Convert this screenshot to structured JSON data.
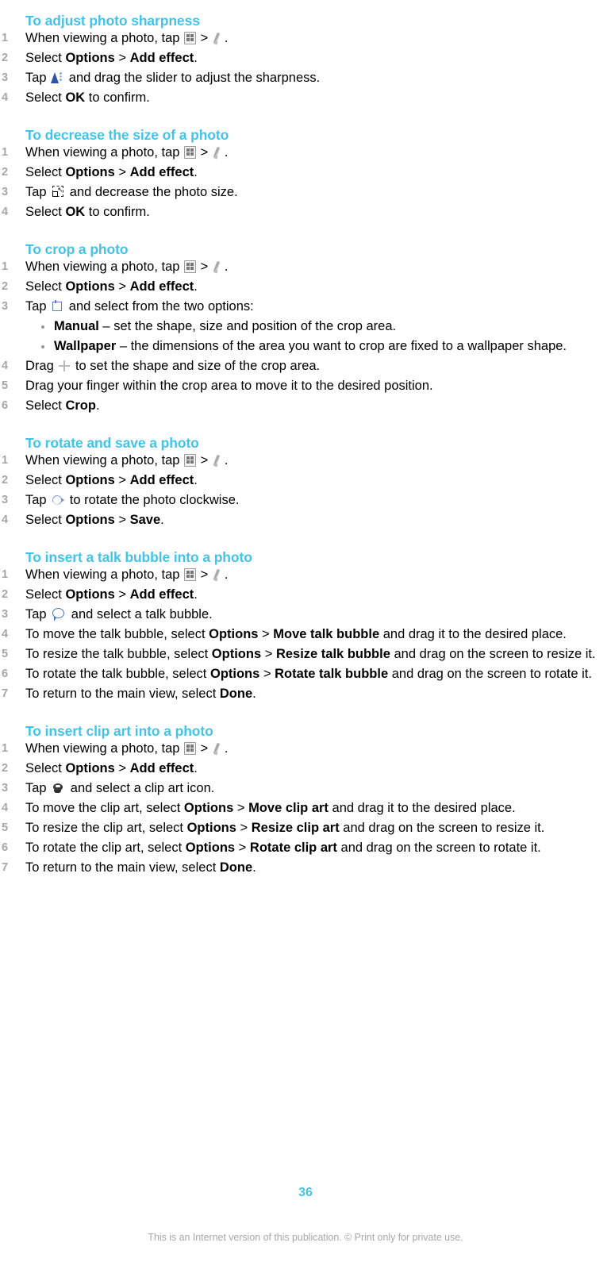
{
  "document": {
    "page_number": "36",
    "footer_note": "This is an Internet version of this publication. © Print only for private use.",
    "accent_color": "#42c3ea",
    "number_color": "#a6a6a6"
  },
  "sections": [
    {
      "title": "To adjust photo sharpness",
      "steps": [
        {
          "parts": [
            {
              "t": "text",
              "v": "When viewing a photo, tap "
            },
            {
              "t": "icon",
              "v": "gallery-icon"
            },
            {
              "t": "text",
              "v": " > "
            },
            {
              "t": "icon",
              "v": "pen-icon"
            },
            {
              "t": "text",
              "v": "."
            }
          ]
        },
        {
          "parts": [
            {
              "t": "text",
              "v": "Select "
            },
            {
              "t": "bold",
              "v": "Options"
            },
            {
              "t": "text",
              "v": " > "
            },
            {
              "t": "bold",
              "v": "Add effect"
            },
            {
              "t": "text",
              "v": "."
            }
          ]
        },
        {
          "parts": [
            {
              "t": "text",
              "v": "Tap "
            },
            {
              "t": "icon",
              "v": "sharpness-icon"
            },
            {
              "t": "text",
              "v": " and drag the slider to adjust the sharpness."
            }
          ]
        },
        {
          "parts": [
            {
              "t": "text",
              "v": "Select "
            },
            {
              "t": "bold",
              "v": "OK"
            },
            {
              "t": "text",
              "v": " to confirm."
            }
          ]
        }
      ]
    },
    {
      "title": "To decrease the size of a photo",
      "steps": [
        {
          "parts": [
            {
              "t": "text",
              "v": "When viewing a photo, tap "
            },
            {
              "t": "icon",
              "v": "gallery-icon"
            },
            {
              "t": "text",
              "v": " > "
            },
            {
              "t": "icon",
              "v": "pen-icon"
            },
            {
              "t": "text",
              "v": "."
            }
          ]
        },
        {
          "parts": [
            {
              "t": "text",
              "v": "Select "
            },
            {
              "t": "bold",
              "v": "Options"
            },
            {
              "t": "text",
              "v": " > "
            },
            {
              "t": "bold",
              "v": "Add effect"
            },
            {
              "t": "text",
              "v": "."
            }
          ]
        },
        {
          "parts": [
            {
              "t": "text",
              "v": "Tap "
            },
            {
              "t": "icon",
              "v": "resize-icon"
            },
            {
              "t": "text",
              "v": " and decrease the photo size."
            }
          ]
        },
        {
          "parts": [
            {
              "t": "text",
              "v": "Select "
            },
            {
              "t": "bold",
              "v": "OK"
            },
            {
              "t": "text",
              "v": " to confirm."
            }
          ]
        }
      ]
    },
    {
      "title": "To crop a photo",
      "steps": [
        {
          "parts": [
            {
              "t": "text",
              "v": "When viewing a photo, tap "
            },
            {
              "t": "icon",
              "v": "gallery-icon"
            },
            {
              "t": "text",
              "v": " > "
            },
            {
              "t": "icon",
              "v": "pen-icon"
            },
            {
              "t": "text",
              "v": "."
            }
          ]
        },
        {
          "parts": [
            {
              "t": "text",
              "v": "Select "
            },
            {
              "t": "bold",
              "v": "Options"
            },
            {
              "t": "text",
              "v": " > "
            },
            {
              "t": "bold",
              "v": "Add effect"
            },
            {
              "t": "text",
              "v": "."
            }
          ]
        },
        {
          "parts": [
            {
              "t": "text",
              "v": "Tap "
            },
            {
              "t": "icon",
              "v": "crop-icon"
            },
            {
              "t": "text",
              "v": " and select from the two options:"
            }
          ],
          "bullets": [
            {
              "parts": [
                {
                  "t": "bold",
                  "v": "Manual"
                },
                {
                  "t": "text",
                  "v": " – set the shape, size and position of the crop area."
                }
              ]
            },
            {
              "parts": [
                {
                  "t": "bold",
                  "v": "Wallpaper"
                },
                {
                  "t": "text",
                  "v": " – the dimensions of the area you want to crop are fixed to a wallpaper shape."
                }
              ]
            }
          ]
        },
        {
          "parts": [
            {
              "t": "text",
              "v": "Drag "
            },
            {
              "t": "icon",
              "v": "move-crosshair-icon"
            },
            {
              "t": "text",
              "v": " to set the shape and size of the crop area."
            }
          ]
        },
        {
          "parts": [
            {
              "t": "text",
              "v": "Drag your finger within the crop area to move it to the desired position."
            }
          ]
        },
        {
          "parts": [
            {
              "t": "text",
              "v": "Select "
            },
            {
              "t": "bold",
              "v": "Crop"
            },
            {
              "t": "text",
              "v": "."
            }
          ]
        }
      ]
    },
    {
      "title": "To rotate and save a photo",
      "steps": [
        {
          "parts": [
            {
              "t": "text",
              "v": "When viewing a photo, tap "
            },
            {
              "t": "icon",
              "v": "gallery-icon"
            },
            {
              "t": "text",
              "v": " > "
            },
            {
              "t": "icon",
              "v": "pen-icon"
            },
            {
              "t": "text",
              "v": "."
            }
          ]
        },
        {
          "parts": [
            {
              "t": "text",
              "v": "Select "
            },
            {
              "t": "bold",
              "v": "Options"
            },
            {
              "t": "text",
              "v": " > "
            },
            {
              "t": "bold",
              "v": "Add effect"
            },
            {
              "t": "text",
              "v": "."
            }
          ]
        },
        {
          "parts": [
            {
              "t": "text",
              "v": "Tap "
            },
            {
              "t": "icon",
              "v": "rotate-icon"
            },
            {
              "t": "text",
              "v": " to rotate the photo clockwise."
            }
          ]
        },
        {
          "parts": [
            {
              "t": "text",
              "v": "Select "
            },
            {
              "t": "bold",
              "v": "Options"
            },
            {
              "t": "text",
              "v": " > "
            },
            {
              "t": "bold",
              "v": "Save"
            },
            {
              "t": "text",
              "v": "."
            }
          ]
        }
      ]
    },
    {
      "title": "To insert a talk bubble into a photo",
      "steps": [
        {
          "parts": [
            {
              "t": "text",
              "v": "When viewing a photo, tap "
            },
            {
              "t": "icon",
              "v": "gallery-icon"
            },
            {
              "t": "text",
              "v": " > "
            },
            {
              "t": "icon",
              "v": "pen-icon"
            },
            {
              "t": "text",
              "v": "."
            }
          ]
        },
        {
          "parts": [
            {
              "t": "text",
              "v": "Select "
            },
            {
              "t": "bold",
              "v": "Options"
            },
            {
              "t": "text",
              "v": " > "
            },
            {
              "t": "bold",
              "v": "Add effect"
            },
            {
              "t": "text",
              "v": "."
            }
          ]
        },
        {
          "parts": [
            {
              "t": "text",
              "v": "Tap "
            },
            {
              "t": "icon",
              "v": "talk-bubble-icon"
            },
            {
              "t": "text",
              "v": " and select a talk bubble."
            }
          ]
        },
        {
          "parts": [
            {
              "t": "text",
              "v": "To move the talk bubble, select "
            },
            {
              "t": "bold",
              "v": "Options"
            },
            {
              "t": "text",
              "v": " > "
            },
            {
              "t": "bold",
              "v": "Move talk bubble"
            },
            {
              "t": "text",
              "v": " and drag it to the desired place."
            }
          ]
        },
        {
          "parts": [
            {
              "t": "text",
              "v": "To resize the talk bubble, select "
            },
            {
              "t": "bold",
              "v": "Options"
            },
            {
              "t": "text",
              "v": " > "
            },
            {
              "t": "bold",
              "v": "Resize talk bubble"
            },
            {
              "t": "text",
              "v": " and drag on the screen to resize it."
            }
          ]
        },
        {
          "parts": [
            {
              "t": "text",
              "v": "To rotate the talk bubble, select "
            },
            {
              "t": "bold",
              "v": "Options"
            },
            {
              "t": "text",
              "v": " > "
            },
            {
              "t": "bold",
              "v": "Rotate talk bubble"
            },
            {
              "t": "text",
              "v": " and drag on the screen to rotate it."
            }
          ]
        },
        {
          "parts": [
            {
              "t": "text",
              "v": "To return to the main view, select "
            },
            {
              "t": "bold",
              "v": "Done"
            },
            {
              "t": "text",
              "v": "."
            }
          ]
        }
      ]
    },
    {
      "title": "To insert clip art into a photo",
      "steps": [
        {
          "parts": [
            {
              "t": "text",
              "v": "When viewing a photo, tap "
            },
            {
              "t": "icon",
              "v": "gallery-icon"
            },
            {
              "t": "text",
              "v": " > "
            },
            {
              "t": "icon",
              "v": "pen-icon"
            },
            {
              "t": "text",
              "v": "."
            }
          ]
        },
        {
          "parts": [
            {
              "t": "text",
              "v": "Select "
            },
            {
              "t": "bold",
              "v": "Options"
            },
            {
              "t": "text",
              "v": " > "
            },
            {
              "t": "bold",
              "v": "Add effect"
            },
            {
              "t": "text",
              "v": "."
            }
          ]
        },
        {
          "parts": [
            {
              "t": "text",
              "v": "Tap "
            },
            {
              "t": "icon",
              "v": "clip-art-icon"
            },
            {
              "t": "text",
              "v": " and select a clip art icon."
            }
          ]
        },
        {
          "parts": [
            {
              "t": "text",
              "v": "To move the clip art, select "
            },
            {
              "t": "bold",
              "v": "Options"
            },
            {
              "t": "text",
              "v": " > "
            },
            {
              "t": "bold",
              "v": "Move clip art"
            },
            {
              "t": "text",
              "v": " and drag it to the desired place."
            }
          ]
        },
        {
          "parts": [
            {
              "t": "text",
              "v": "To resize the clip art, select "
            },
            {
              "t": "bold",
              "v": "Options"
            },
            {
              "t": "text",
              "v": " > "
            },
            {
              "t": "bold",
              "v": "Resize clip art"
            },
            {
              "t": "text",
              "v": " and drag on the screen to resize it."
            }
          ]
        },
        {
          "parts": [
            {
              "t": "text",
              "v": "To rotate the clip art, select "
            },
            {
              "t": "bold",
              "v": "Options"
            },
            {
              "t": "text",
              "v": " > "
            },
            {
              "t": "bold",
              "v": "Rotate clip art"
            },
            {
              "t": "text",
              "v": " and drag on the screen to rotate it."
            }
          ]
        },
        {
          "parts": [
            {
              "t": "text",
              "v": "To return to the main view, select "
            },
            {
              "t": "bold",
              "v": "Done"
            },
            {
              "t": "text",
              "v": "."
            }
          ]
        }
      ]
    }
  ]
}
